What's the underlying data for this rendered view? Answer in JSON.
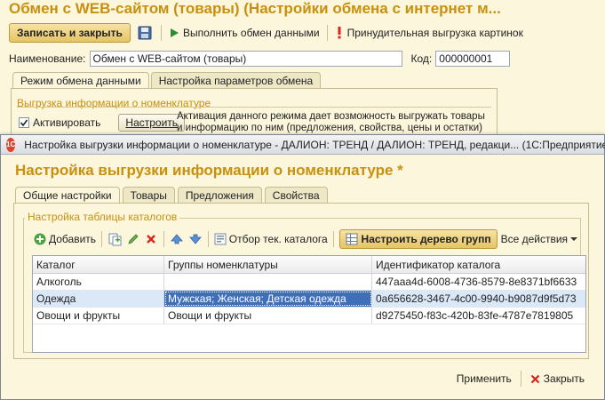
{
  "main_window": {
    "title": "Обмен с WEB-сайтом (товары) (Настройки обмена с интернет м...",
    "toolbar": {
      "save_close": "Записать и закрыть",
      "run_exchange": "Выполнить обмен данными",
      "force_images": "Принудительная выгрузка картинок"
    },
    "name_label": "Наименование:",
    "name_value": "Обмен с WEB-сайтом (товары)",
    "code_label": "Код:",
    "code_value": "000000001",
    "tabs": [
      {
        "label": "Режим обмена данными"
      },
      {
        "label": "Настройка параметров обмена"
      }
    ],
    "group_title": "Выгрузка информации о номенклатуре",
    "activate_label": "Активировать",
    "activate_checked": true,
    "configure_button": "Настроить",
    "description": "Активация данного режима дает возможность выгружать товары и информацию по ним (предложения, свойства, цены и остатки)"
  },
  "dialog": {
    "window_title": "Настройка выгрузки информации о номенклатуре - ДАЛИОН: ТРЕНД / ДАЛИОН: ТРЕНД, редакци...  (1С:Предприятие)",
    "app_logo": "1С",
    "heading": "Настройка выгрузки информации о номенклатуре *",
    "tabs": [
      {
        "label": "Общие настройки"
      },
      {
        "label": "Товары"
      },
      {
        "label": "Предложения"
      },
      {
        "label": "Свойства"
      }
    ],
    "group_title": "Настройка таблицы каталогов",
    "toolbar": {
      "add": "Добавить",
      "filter_catalog": "Отбор тек. каталога",
      "setup_tree": "Настроить дерево групп",
      "all_actions": "Все действия"
    },
    "table": {
      "columns": [
        "Каталог",
        "Группы номенклатуры",
        "Идентификатор каталога"
      ],
      "rows": [
        [
          "Алкоголь",
          "",
          "447aaa4d-6008-4736-8579-8e8371bf6633"
        ],
        [
          "Одежда",
          "Мужская; Женская; Детская одежда",
          "0a656628-3467-4c00-9940-b9087d9f5d73"
        ],
        [
          "Овощи и фрукты",
          "Овощи и фрукты",
          "d9275450-f83c-420b-83fe-4787e7819805"
        ]
      ]
    },
    "footer": {
      "apply": "Применить",
      "close": "Закрыть"
    }
  },
  "colors": {
    "accent": "#c8900f",
    "background": "#fbf6dc",
    "selection": "#3f6fb8"
  }
}
